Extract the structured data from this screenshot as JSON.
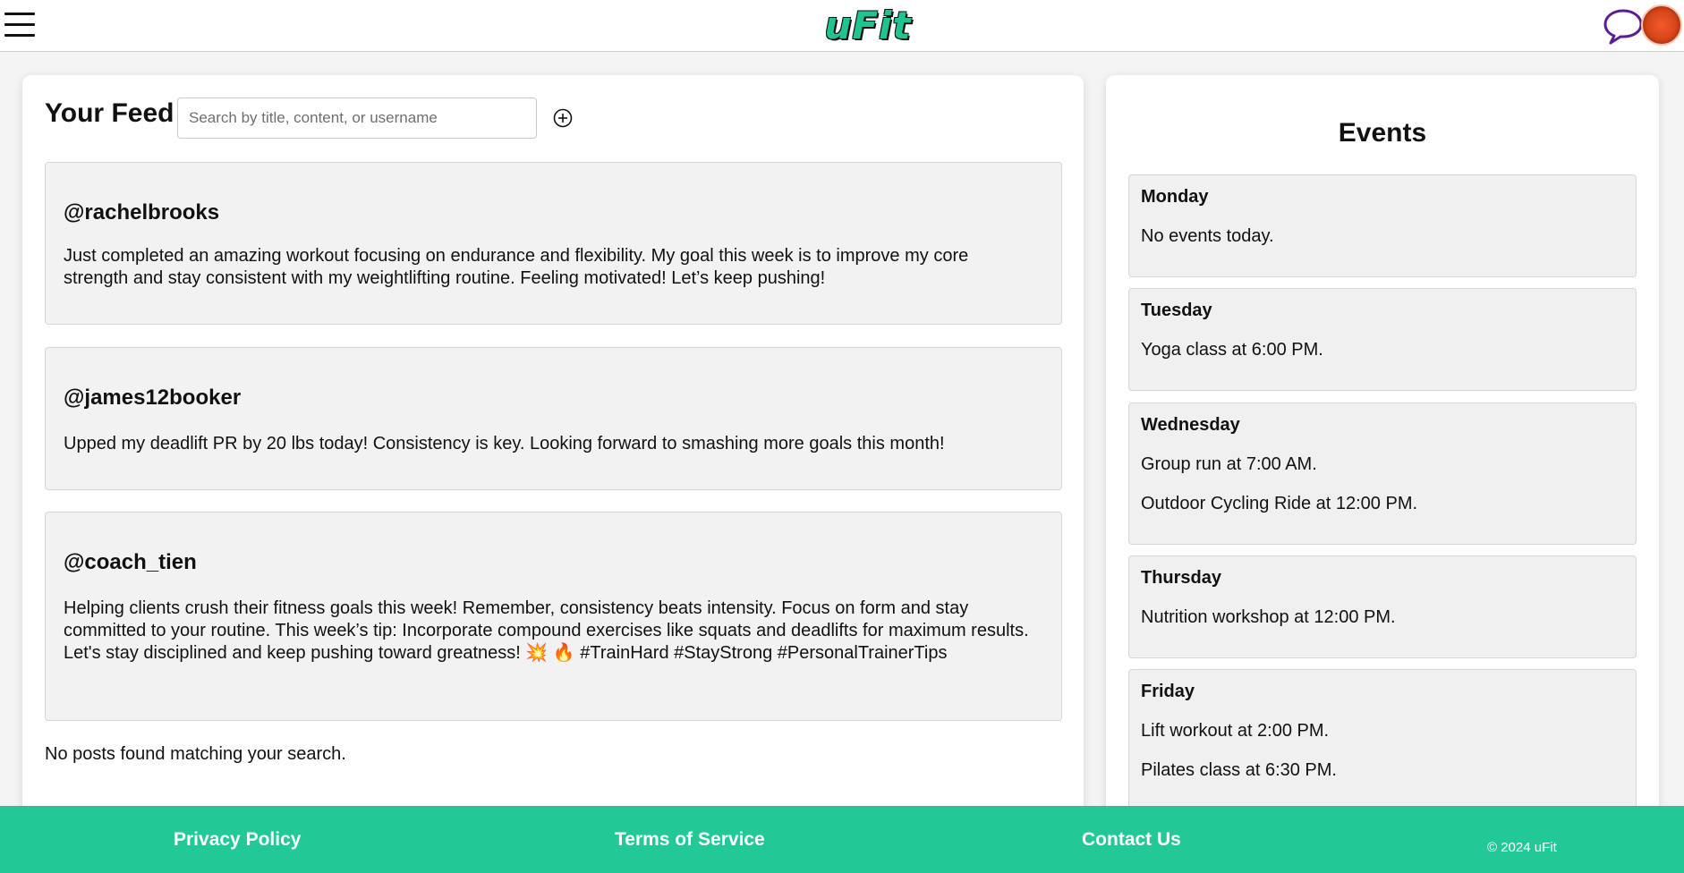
{
  "app": {
    "logo": "uFit"
  },
  "colors": {
    "brand": "#22c895",
    "chat_icon": "#5b1d8f",
    "avatar": "#e0502a"
  },
  "feed": {
    "title": "Your Feed",
    "search": {
      "placeholder": "Search by title, content, or username",
      "value": ""
    },
    "posts": [
      {
        "username": "@rachelbrooks",
        "content": "Just completed an amazing workout focusing on endurance and flexibility. My goal this week is to improve my core strength and stay consistent with my weightlifting routine. Feeling motivated! Let’s keep pushing!"
      },
      {
        "username": "@james12booker",
        "content": "Upped my deadlift PR by 20 lbs today! Consistency is key. Looking forward to smashing more goals this month!"
      },
      {
        "username": "@coach_tien",
        "content": "Helping clients crush their fitness goals this week! Remember, consistency beats intensity. Focus on form and stay committed to your routine. This week’s tip: Incorporate compound exercises like squats and deadlifts for maximum results. Let's stay disciplined and keep pushing toward greatness! 💥 🔥 #TrainHard #StayStrong #PersonalTrainerTips"
      }
    ],
    "empty_message": "No posts found matching your search."
  },
  "events": {
    "title": "Events",
    "days": [
      {
        "day": "Monday",
        "items": [
          "No events today."
        ]
      },
      {
        "day": "Tuesday",
        "items": [
          "Yoga class at 6:00 PM."
        ]
      },
      {
        "day": "Wednesday",
        "items": [
          "Group run at 7:00 AM.",
          "Outdoor Cycling Ride at 12:00 PM."
        ]
      },
      {
        "day": "Thursday",
        "items": [
          "Nutrition workshop at 12:00 PM."
        ]
      },
      {
        "day": "Friday",
        "items": [
          "Lift workout at 2:00 PM.",
          "Pilates class at 6:30 PM."
        ]
      }
    ]
  },
  "footer": {
    "privacy": "Privacy Policy",
    "terms": "Terms of Service",
    "contact": "Contact Us",
    "copyright": "© 2024 uFit"
  }
}
